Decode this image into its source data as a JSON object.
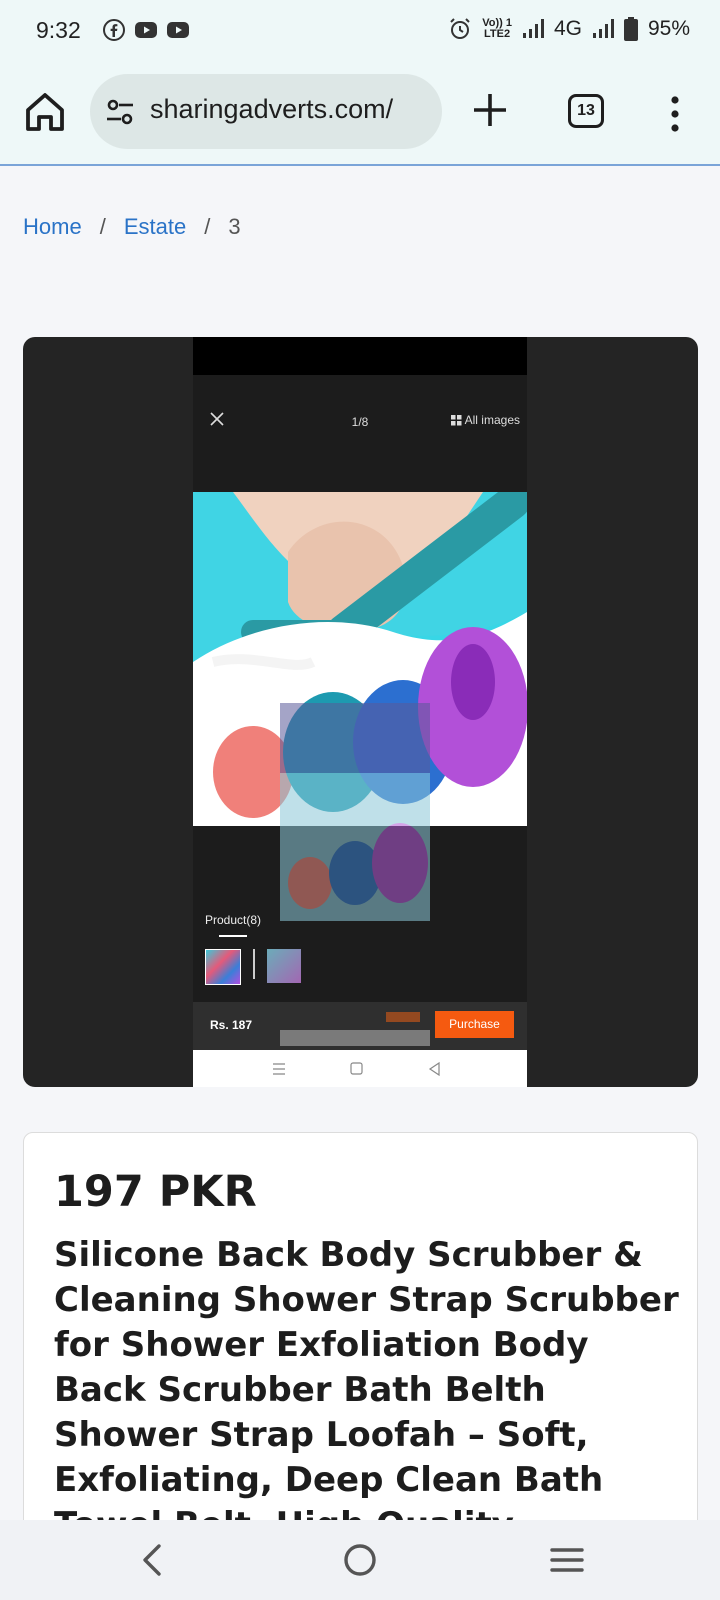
{
  "status_bar": {
    "time": "9:32",
    "notifications": [
      "facebook-icon",
      "youtube-icon",
      "youtube-icon"
    ],
    "volte_line1": "Vo)) 1",
    "volte_line2": "LTE2",
    "network": "4G",
    "battery": "95%"
  },
  "browser": {
    "url": "sharingadverts.com/",
    "tab_count": "13"
  },
  "breadcrumb": {
    "home": "Home",
    "category": "Estate",
    "current": "3",
    "separator": "/"
  },
  "gallery": {
    "counter": "1/8",
    "all_images": "All images",
    "product_tab": "Product(8)",
    "price": "Rs. 187",
    "purchase": "Purchase"
  },
  "product": {
    "price": "197 PKR",
    "title": "Silicone Back Body Scrubber & Cleaning Shower Strap Scrubber for Shower Exfoliation Body Back Scrubber Bath Belth Shower Strap Loofah – Soft, Exfoliating, Deep Clean Bath Towel Belt, High Quality"
  },
  "colors": {
    "link": "#2a73c7",
    "purchase_button": "#f55a10",
    "browser_bar": "#eef8f8"
  }
}
